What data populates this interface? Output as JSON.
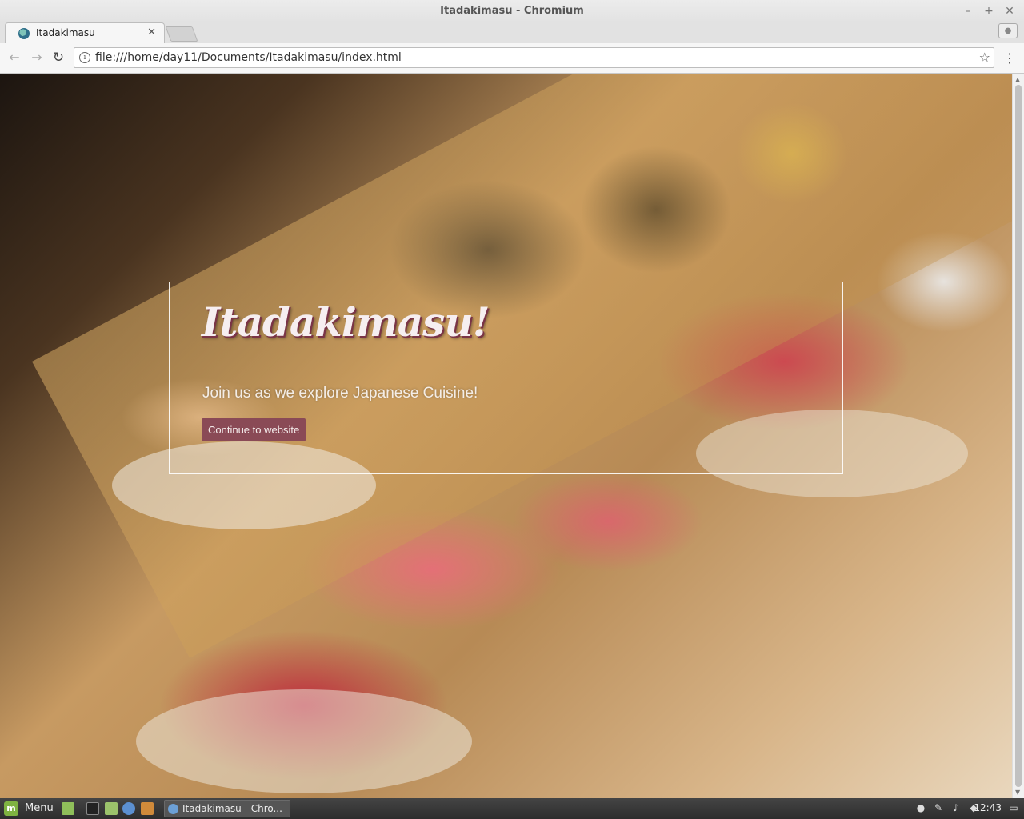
{
  "window": {
    "title": "Itadakimasu - Chromium",
    "controls": [
      "–",
      "+",
      "✕"
    ]
  },
  "tab": {
    "title": "Itadakimasu",
    "close": "✕"
  },
  "toolbar": {
    "back": "←",
    "forward": "→",
    "reload": "↻",
    "info": "i",
    "url": "file:///home/day11/Documents/Itadakimasu/index.html",
    "star": "☆",
    "menu": "⋮"
  },
  "page": {
    "heading": "Itadakimasu!",
    "tagline": "Join us as we explore Japanese Cuisine!",
    "cta": "Continue to website"
  },
  "taskbar": {
    "menu_label": "Menu",
    "window_item": "Itadakimasu - Chro...",
    "clock": "12:43"
  },
  "colors": {
    "cta_background": "#8a4a56",
    "heading_shadow": "#7a3446"
  }
}
